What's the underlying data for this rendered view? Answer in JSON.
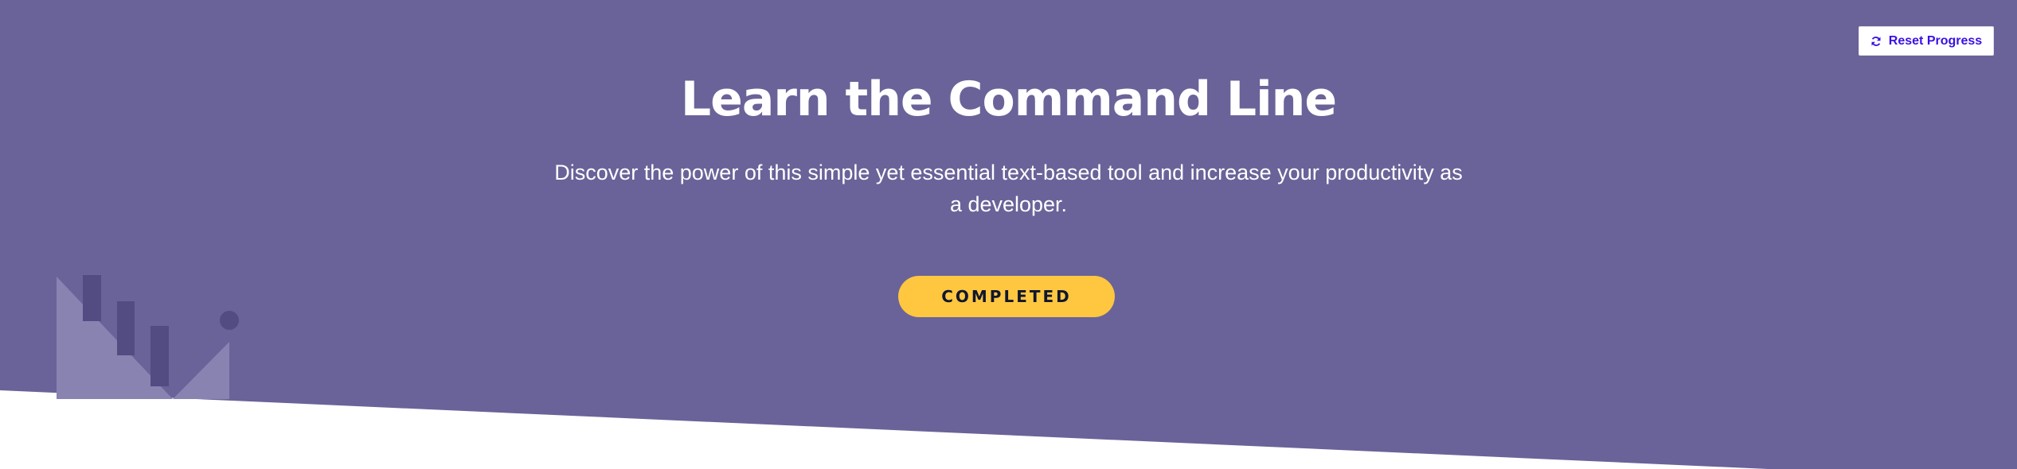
{
  "hero": {
    "title": "Learn the Command Line",
    "description": "Discover the power of this simple yet essential text-based tool and increase your productivity as a developer.",
    "status_button_label": "COMPLETED",
    "background_color": "#6a6399",
    "status_button_color": "#ffc740"
  },
  "toolbar": {
    "reset_label": "Reset Progress",
    "reset_icon": "refresh-icon",
    "accent_color": "#3a10e5"
  }
}
